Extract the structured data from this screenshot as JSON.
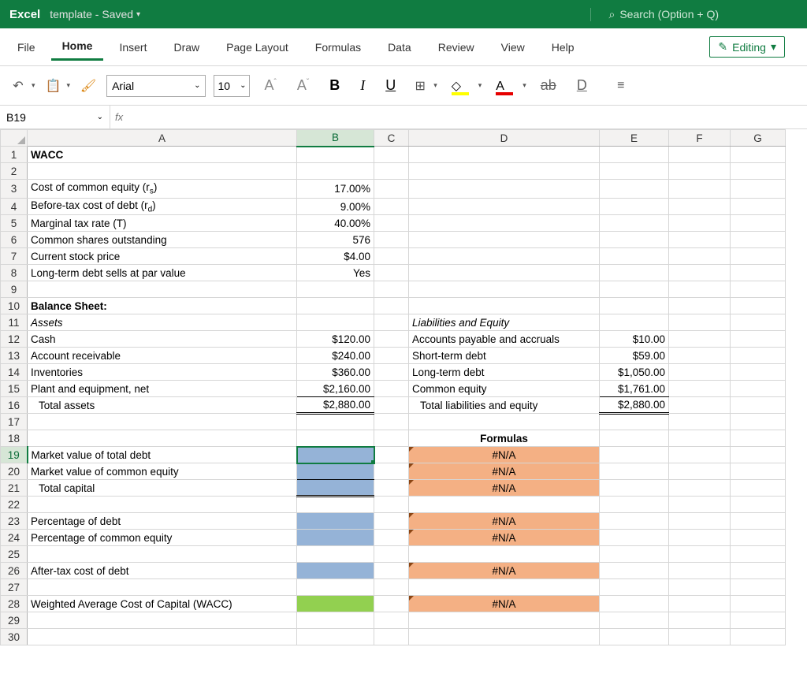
{
  "title": {
    "app": "Excel",
    "doc": "template - Saved"
  },
  "search": "Search (Option + Q)",
  "tabs": [
    "File",
    "Home",
    "Insert",
    "Draw",
    "Page Layout",
    "Formulas",
    "Data",
    "Review",
    "View",
    "Help"
  ],
  "editing": "Editing",
  "font": {
    "name": "Arial",
    "size": "10"
  },
  "namebox": "B19",
  "colhdrs": [
    "A",
    "B",
    "C",
    "D",
    "E",
    "F",
    "G"
  ],
  "cells": {
    "a1": "WACC",
    "a3": "Cost of common equity (r",
    "a3sub": "s",
    "a3end": ")",
    "b3": "17.00%",
    "a4": "Before-tax cost of debt (r",
    "a4sub": "d",
    "a4end": ")",
    "b4": "9.00%",
    "a5": "Marginal tax rate (T)",
    "b5": "40.00%",
    "a6": "Common shares outstanding",
    "b6": "576",
    "a7": "Current stock price",
    "b7": "$4.00",
    "a8": "Long-term debt sells at par value",
    "b8": "Yes",
    "a10": "Balance Sheet:",
    "a11": "Assets",
    "d11": "Liabilities and Equity",
    "a12": "Cash",
    "b12": "$120.00",
    "d12": "Accounts payable and accruals",
    "e12": "$10.00",
    "a13": "Account receivable",
    "b13": "$240.00",
    "d13": "Short-term debt",
    "e13": "$59.00",
    "a14": "Inventories",
    "b14": "$360.00",
    "d14": "Long-term debt",
    "e14": "$1,050.00",
    "a15": "Plant and equipment, net",
    "b15": "$2,160.00",
    "d15": "Common equity",
    "e15": "$1,761.00",
    "a16": "Total assets",
    "b16": "$2,880.00",
    "d16": "Total liabilities and equity",
    "e16": "$2,880.00",
    "d18": "Formulas",
    "a19": "Market value of total debt",
    "d19": "#N/A",
    "a20": "Market value of common equity",
    "d20": "#N/A",
    "a21": "Total capital",
    "d21": "#N/A",
    "a23": "Percentage of debt",
    "d23": "#N/A",
    "a24": "Percentage of common equity",
    "d24": "#N/A",
    "a26": "After-tax cost of debt",
    "d26": "#N/A",
    "a28": "Weighted Average Cost of Capital (WACC)",
    "d28": "#N/A"
  }
}
